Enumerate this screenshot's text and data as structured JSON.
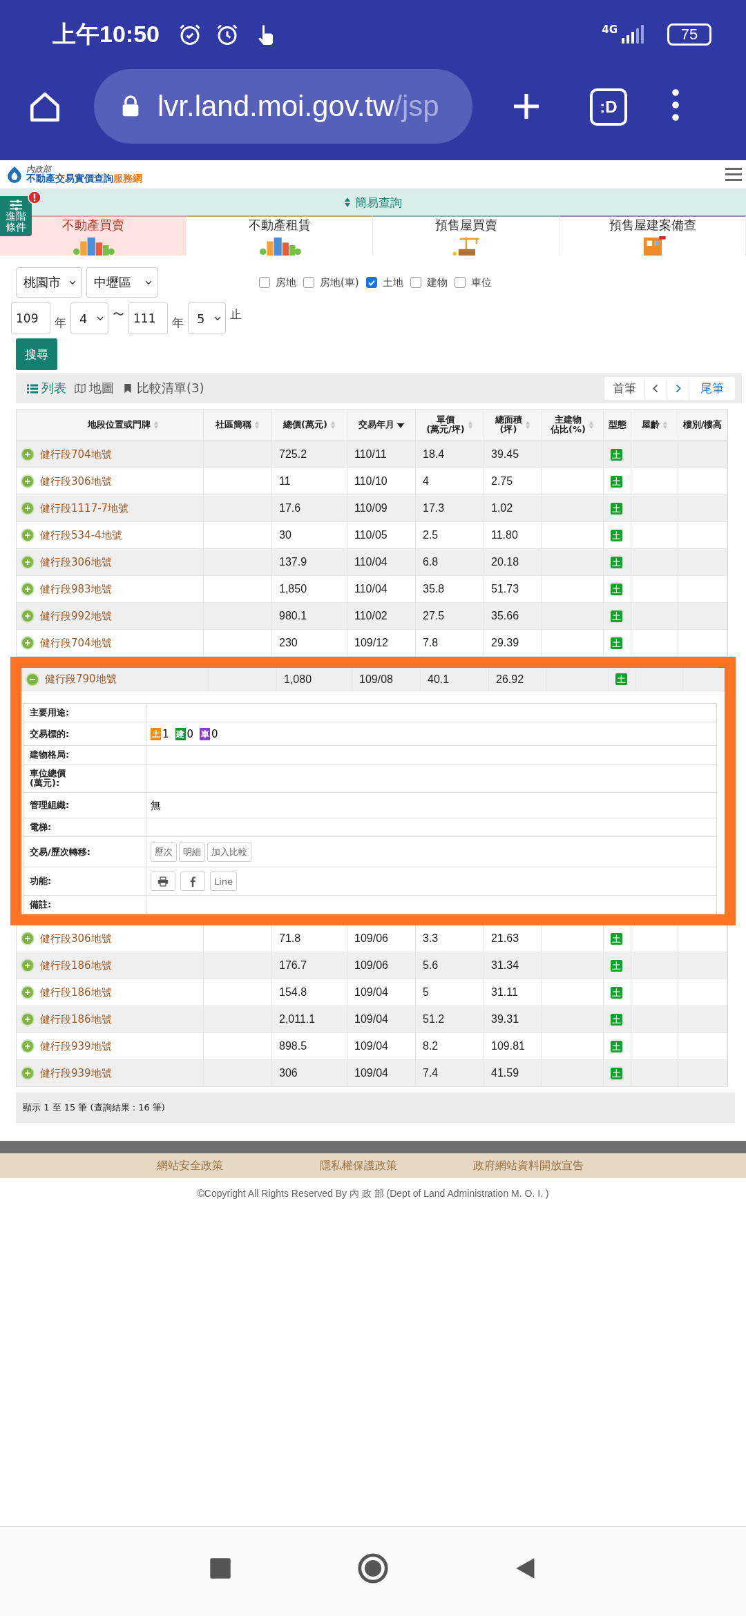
{
  "status_bar": {
    "time": "上午10:50",
    "network": "4G",
    "battery": "75"
  },
  "browser": {
    "url_host": "lvr.land.moi.gov.tw",
    "url_path": "/jsp",
    "tab_switcher": ":D"
  },
  "site": {
    "org": "內政部",
    "title": "不動產交易實價查詢",
    "title_suffix": "服務網"
  },
  "advanced_toggle": {
    "label": "進階條件"
  },
  "mode_bar": {
    "label": "簡易查詢"
  },
  "tabs": [
    {
      "label": "不動產買賣",
      "selected": true,
      "color": "#e8a0a0"
    },
    {
      "label": "不動產租賃",
      "selected": false,
      "color": "#c9a46a"
    },
    {
      "label": "預售屋買賣",
      "selected": false,
      "color": "#7fb8b0"
    },
    {
      "label": "預售屋建案備查",
      "selected": false,
      "color": "#9a7fc9"
    }
  ],
  "filters": {
    "city": "桃園市",
    "district": "中壢區",
    "types": [
      {
        "label": "房地",
        "checked": false
      },
      {
        "label": "房地(車)",
        "checked": false
      },
      {
        "label": "土地",
        "checked": true
      },
      {
        "label": "建物",
        "checked": false
      },
      {
        "label": "車位",
        "checked": false
      }
    ],
    "date_range": [
      {
        "kind": "input",
        "value": "109"
      },
      {
        "kind": "text",
        "value": "年"
      },
      {
        "kind": "select",
        "value": "4"
      },
      {
        "kind": "text",
        "value": "〜"
      },
      {
        "kind": "input",
        "value": "111"
      },
      {
        "kind": "text",
        "value": "年"
      },
      {
        "kind": "select",
        "value": "5"
      },
      {
        "kind": "text",
        "value": "止"
      }
    ],
    "search_button": "搜尋"
  },
  "view_tabs": [
    {
      "label": "列表",
      "kind": "list",
      "selected": true
    },
    {
      "label": "地圖",
      "kind": "map",
      "selected": false
    },
    {
      "label": "比較清單(3)",
      "kind": "bookmark",
      "selected": false
    }
  ],
  "pager": {
    "first": "首筆",
    "last": "尾筆"
  },
  "table": {
    "columns": [
      {
        "lines": [
          "地段位置或門牌"
        ],
        "sortable": true,
        "sorted": false
      },
      {
        "lines": [
          "社區簡稱"
        ],
        "sortable": true,
        "sorted": false
      },
      {
        "lines": [
          "總價(萬元)"
        ],
        "sortable": true,
        "sorted": false
      },
      {
        "lines": [
          "交易年月"
        ],
        "sortable": true,
        "sorted": true
      },
      {
        "lines": [
          "單價",
          "(萬元/坪)"
        ],
        "sortable": true,
        "sorted": false
      },
      {
        "lines": [
          "總面積",
          "(坪)"
        ],
        "sortable": true,
        "sorted": false
      },
      {
        "lines": [
          "主建物",
          "佔比(%)"
        ],
        "sortable": true,
        "sorted": false
      },
      {
        "lines": [
          "型態"
        ],
        "sortable": false
      },
      {
        "lines": [
          "屋齡"
        ],
        "sortable": true,
        "sorted": false
      },
      {
        "lines": [
          "樓別/樓高"
        ],
        "sortable": false
      }
    ],
    "rows": [
      {
        "address": "健行段704地號",
        "total": "725.2",
        "date": "110/11",
        "unit_price": "18.4",
        "area": "39.45",
        "type": "土",
        "expanded": false
      },
      {
        "address": "健行段306地號",
        "total": "11",
        "date": "110/10",
        "unit_price": "4",
        "area": "2.75",
        "type": "土",
        "expanded": false
      },
      {
        "address": "健行段1117-7地號",
        "total": "17.6",
        "date": "110/09",
        "unit_price": "17.3",
        "area": "1.02",
        "type": "土",
        "expanded": false
      },
      {
        "address": "健行段534-4地號",
        "total": "30",
        "date": "110/05",
        "unit_price": "2.5",
        "area": "11.80",
        "type": "土",
        "expanded": false
      },
      {
        "address": "健行段306地號",
        "total": "137.9",
        "date": "110/04",
        "unit_price": "6.8",
        "area": "20.18",
        "type": "土",
        "expanded": false
      },
      {
        "address": "健行段983地號",
        "total": "1,850",
        "date": "110/04",
        "unit_price": "35.8",
        "area": "51.73",
        "type": "土",
        "expanded": false
      },
      {
        "address": "健行段992地號",
        "total": "980.1",
        "date": "110/02",
        "unit_price": "27.5",
        "area": "35.66",
        "type": "土",
        "expanded": false
      },
      {
        "address": "健行段704地號",
        "total": "230",
        "date": "109/12",
        "unit_price": "7.8",
        "area": "29.39",
        "type": "土",
        "expanded": false
      },
      {
        "address": "健行段790地號",
        "total": "1,080",
        "date": "109/08",
        "unit_price": "40.1",
        "area": "26.92",
        "type": "土",
        "expanded": true,
        "detail": [
          {
            "label": "主要用途:",
            "kind": "text"
          },
          {
            "label": "交易標的:",
            "kind": "targets",
            "targets": [
              {
                "badge": "土",
                "count": "1",
                "color": "#f08c1e"
              },
              {
                "badge": "建",
                "count": "0",
                "color": "#10962c"
              },
              {
                "badge": "車",
                "count": "0",
                "color": "#8a3fc8"
              }
            ]
          },
          {
            "label": "建物格局:",
            "kind": "text"
          },
          {
            "lines": [
              "車位總價",
              "(萬元):"
            ],
            "kind": "text"
          },
          {
            "label": "管理組織:",
            "kind": "text",
            "value": "無"
          },
          {
            "label": "電梯:",
            "kind": "text"
          },
          {
            "label": "交易/歷次轉移:",
            "kind": "buttons",
            "buttons": [
              "歷次",
              "明細",
              "加入比較"
            ]
          },
          {
            "label": "功能:",
            "kind": "share",
            "line_label": "Line"
          },
          {
            "label": "備註:",
            "kind": "text"
          }
        ]
      },
      {
        "address": "健行段306地號",
        "total": "71.8",
        "date": "109/06",
        "unit_price": "3.3",
        "area": "21.63",
        "type": "土",
        "expanded": false
      },
      {
        "address": "健行段186地號",
        "total": "176.7",
        "date": "109/06",
        "unit_price": "5.6",
        "area": "31.34",
        "type": "土",
        "expanded": false
      },
      {
        "address": "健行段186地號",
        "total": "154.8",
        "date": "109/04",
        "unit_price": "5",
        "area": "31.11",
        "type": "土",
        "expanded": false
      },
      {
        "address": "健行段186地號",
        "total": "2,011.1",
        "date": "109/04",
        "unit_price": "51.2",
        "area": "39.31",
        "type": "土",
        "expanded": false
      },
      {
        "address": "健行段939地號",
        "total": "898.5",
        "date": "109/04",
        "unit_price": "8.2",
        "area": "109.81",
        "type": "土",
        "expanded": false
      },
      {
        "address": "健行段939地號",
        "total": "306",
        "date": "109/04",
        "unit_price": "7.4",
        "area": "41.59",
        "type": "土",
        "expanded": false
      }
    ]
  },
  "summary": "顯示 1 至 15 筆 (查詢結果 : 16 筆)",
  "footer": {
    "links": [
      "網站安全政策",
      "隱私權保護政策",
      "政府網站資料開放宣告"
    ],
    "copyright": "©Copyright All Rights Reserved By 內 政 部 (Dept of Land Administration M. O. I. )"
  }
}
